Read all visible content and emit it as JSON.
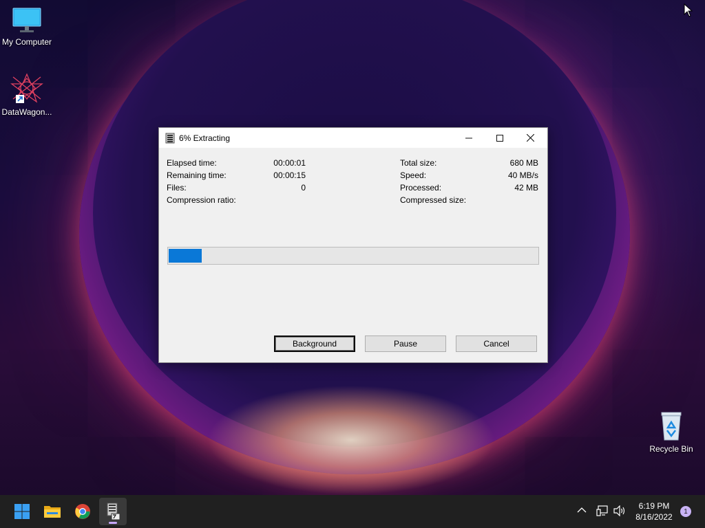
{
  "desktop": {
    "icons": [
      {
        "label": "My Computer",
        "icon": "monitor-icon"
      },
      {
        "label": "DataWagon...",
        "icon": "datawagon-shortcut-icon"
      },
      {
        "label": "Recycle Bin",
        "icon": "recycle-bin-icon"
      }
    ]
  },
  "dialog": {
    "title": "6% Extracting",
    "app_icon": "7zip-icon",
    "left_stats": [
      {
        "label": "Elapsed time:",
        "value": "00:00:01"
      },
      {
        "label": "Remaining time:",
        "value": "00:00:15"
      },
      {
        "label": "Files:",
        "value": "0"
      },
      {
        "label": "Compression ratio:",
        "value": ""
      }
    ],
    "right_stats": [
      {
        "label": "Total size:",
        "value": "680 MB"
      },
      {
        "label": "Speed:",
        "value": "40 MB/s"
      },
      {
        "label": "Processed:",
        "value": "42 MB"
      },
      {
        "label": "Compressed size:",
        "value": ""
      }
    ],
    "progress_percent": 6,
    "buttons": {
      "background": "Background",
      "pause": "Pause",
      "cancel": "Cancel"
    },
    "progress_color": "#0a78d7"
  },
  "taskbar": {
    "apps": [
      "windows-start-icon",
      "file-explorer-icon",
      "chrome-icon",
      "7zip-icon"
    ],
    "tray": {
      "icons": [
        "chevron-up-icon",
        "network-icon",
        "volume-icon"
      ]
    },
    "clock": {
      "time": "6:19 PM",
      "date": "8/16/2022"
    },
    "notification_count": "1"
  }
}
